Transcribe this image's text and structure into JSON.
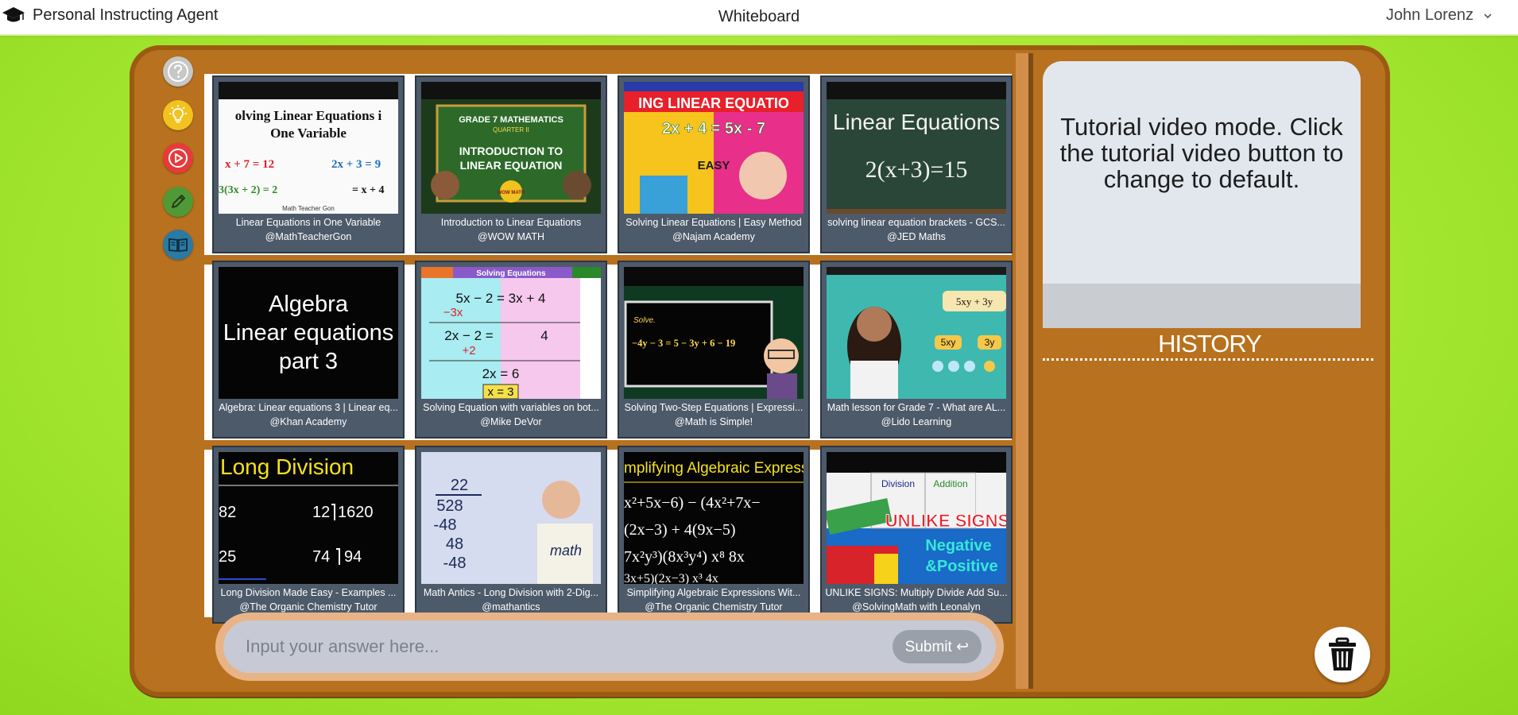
{
  "header": {
    "brand": "Personal Instructing Agent",
    "title": "Whiteboard",
    "user": "John Lorenz"
  },
  "videos": [
    {
      "title": "Linear Equations in One Variable",
      "channel": "@MathTeacherGon",
      "thumb_text": [
        "olving Linear Equations i",
        "One Variable",
        "x + 7 = 12",
        "2x + 3 = 9",
        "3(3x + 2) = 2",
        "= x + 4",
        "Math Teacher Gon"
      ]
    },
    {
      "title": "Introduction to Linear Equations",
      "channel": "@WOW MATH",
      "thumb_text": [
        "GRADE 7 MATHEMATICS",
        "QUARTER II",
        "INTRODUCTION TO",
        "LINEAR EQUATION",
        "WOW MATH"
      ]
    },
    {
      "title": "Solving Linear Equations | Easy Method",
      "channel": "@Najam Academy",
      "thumb_text": [
        "ING LINEAR EQUATIO",
        "2x + 4 = 5x - 7",
        "EASY"
      ]
    },
    {
      "title": "solving linear equation brackets - GCS...",
      "channel": "@JED Maths",
      "thumb_text": [
        "Linear Equations",
        "2(x+3)=15"
      ]
    },
    {
      "title": "Algebra: Linear equations 3 | Linear eq...",
      "channel": "@Khan Academy",
      "thumb_text": [
        "Algebra",
        "Linear equations",
        "part 3"
      ]
    },
    {
      "title": "Solving Equation with variables on bot...",
      "channel": "@Mike DeVor",
      "thumb_text": [
        "Solving Equations",
        "5x − 2 = 3x + 4",
        "−3x",
        "2x − 2 =",
        "4",
        "+2",
        "2x = 6",
        "x = 3"
      ]
    },
    {
      "title": "Solving Two-Step Equations | Expressi...",
      "channel": "@Math is Simple!",
      "thumb_text": [
        "Solve.",
        "−4y − 3 = 5 − 3y + 6 − 19"
      ]
    },
    {
      "title": "Math lesson for Grade 7 - What are AL...",
      "channel": "@Lido Learning",
      "thumb_text": [
        "5xy + 3y",
        "5xy",
        "3y"
      ]
    },
    {
      "title": "Long Division Made Easy - Examples ...",
      "channel": "@The Organic Chemistry Tutor",
      "thumb_text": [
        "Long Division",
        "82",
        "12",
        "1620",
        "25",
        "74",
        "94"
      ]
    },
    {
      "title": "Math Antics - Long Division with 2-Dig...",
      "channel": "@mathantics",
      "thumb_text": [
        "22",
        "528",
        "-48",
        "48",
        "-48",
        "math"
      ]
    },
    {
      "title": "Simplifying Algebraic Expressions Wit...",
      "channel": "@The Organic Chemistry Tutor",
      "thumb_text": [
        "mplifying Algebraic Expressio"
      ]
    },
    {
      "title": "UNLIKE SIGNS: Multiply Divide Add Su...",
      "channel": "@SolvingMath with Leonalyn",
      "thumb_text": [
        "Division",
        "Addition",
        "UNLIKE SIGNS",
        "Negative",
        "&Positive"
      ]
    }
  ],
  "tutorial": {
    "message": "Tutorial video mode. Click the tutorial video button to change to default."
  },
  "history": {
    "title": "HISTORY"
  },
  "answer": {
    "placeholder": "Input your answer here...",
    "submit_label": "Submit ↩"
  },
  "colors": {
    "background": "#a6e832",
    "board": "#b8711e",
    "card": "#4d5a6a",
    "help": "#c7c7c7",
    "hint": "#f2c21f",
    "video": "#e83a3a",
    "pencil": "#4f9a37",
    "book": "#2a7aa3"
  },
  "icons": [
    "graduation-cap-icon",
    "chevron-down-icon",
    "help-icon",
    "lightbulb-icon",
    "play-icon",
    "pencil-icon",
    "book-icon",
    "trash-icon"
  ]
}
